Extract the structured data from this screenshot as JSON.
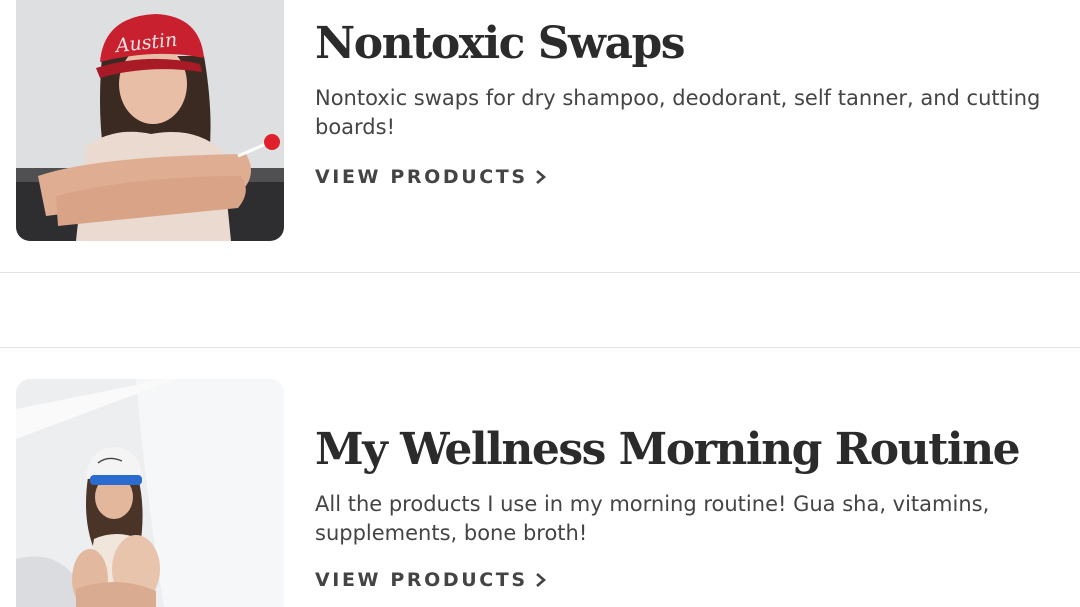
{
  "cards": [
    {
      "title": "Nontoxic Swaps",
      "description": "Nontoxic swaps for dry shampoo, deodorant, self tanner, and cutting boards!",
      "link_label": "VIEW PRODUCTS",
      "link_icon": "chevron-right-icon",
      "hat_text": "Austin"
    },
    {
      "title": "My Wellness Morning Routine",
      "description": "All the products I use in my morning routine! Gua sha, vitamins, supplements, bone broth!",
      "link_label": "VIEW PRODUCTS",
      "link_icon": "chevron-right-icon"
    }
  ],
  "colors": {
    "text": "#2b2b2b",
    "body_text": "#444444",
    "divider": "#e3e3e3",
    "hat_red": "#c8202f"
  }
}
